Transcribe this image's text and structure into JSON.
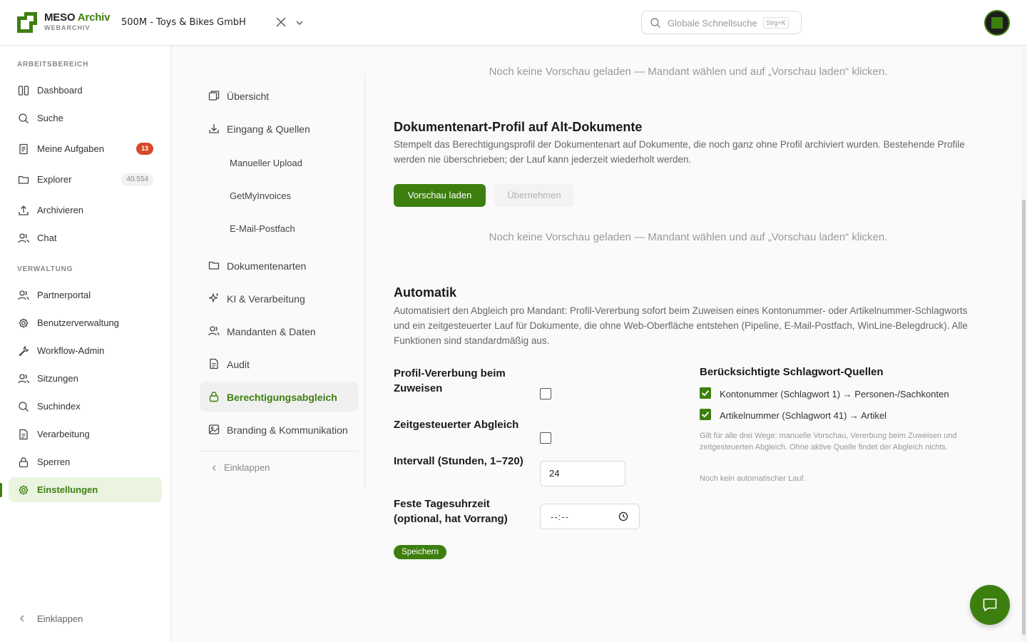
{
  "brand": {
    "name": "MESO",
    "name_accent": "Archiv",
    "sub": "WEBARCHIV"
  },
  "header": {
    "tenant": "500M - Toys & Bikes GmbH",
    "search_placeholder": "Globale Schnellsuche",
    "search_shortcut": "Strg+K"
  },
  "sidebar": {
    "section_work": "ARBEITSBEREICH",
    "section_admin": "VERWALTUNG",
    "work_items": [
      {
        "label": "Dashboard",
        "icon": "dashboard-icon"
      },
      {
        "label": "Suche",
        "icon": "search-icon"
      },
      {
        "label": "Meine Aufgaben",
        "icon": "tasks-icon",
        "badge": "13"
      },
      {
        "label": "Explorer",
        "icon": "folder-icon",
        "count": "40.554"
      },
      {
        "label": "Archivieren",
        "icon": "upload-icon"
      },
      {
        "label": "Chat",
        "icon": "users-icon"
      }
    ],
    "admin_items": [
      {
        "label": "Partnerportal",
        "icon": "users-icon"
      },
      {
        "label": "Benutzerverwaltung",
        "icon": "gear-icon"
      },
      {
        "label": "Workflow-Admin",
        "icon": "wrench-icon"
      },
      {
        "label": "Sitzungen",
        "icon": "users-icon"
      },
      {
        "label": "Suchindex",
        "icon": "search-icon"
      },
      {
        "label": "Verarbeitung",
        "icon": "document-icon"
      },
      {
        "label": "Sperren",
        "icon": "lock-icon"
      },
      {
        "label": "Einstellungen",
        "icon": "gear-icon",
        "active": true
      }
    ],
    "collapse": "Einklappen"
  },
  "subnav": {
    "items": [
      {
        "label": "Übersicht",
        "icon": "copy-icon"
      },
      {
        "label": "Eingang & Quellen",
        "icon": "download-icon"
      },
      {
        "label": "Manueller Upload"
      },
      {
        "label": "GetMyInvoices"
      },
      {
        "label": "E-Mail-Postfach"
      },
      {
        "label": "Dokumentenarten",
        "icon": "folder-icon"
      },
      {
        "label": "KI & Verarbeitung",
        "icon": "sparkle-icon"
      },
      {
        "label": "Mandanten & Daten",
        "icon": "users-icon"
      },
      {
        "label": "Audit",
        "icon": "document-icon"
      },
      {
        "label": "Berechtigungsabgleich",
        "icon": "lock-icon",
        "active": true
      },
      {
        "label": "Branding & Kommunikation",
        "icon": "image-icon"
      }
    ],
    "collapse": "Einklappen"
  },
  "main": {
    "empty_top": "Noch keine Vorschau geladen — Mandant wählen und auf „Vorschau laden“ klicken.",
    "section1": {
      "title": "Dokumentenart-Profil auf Alt-Dokumente",
      "description": "Stempelt das Berechtigungsprofil der Dokumentenart auf Dokumente, die noch ganz ohne Profil archiviert wurden. Bestehende Profile werden nie überschrieben; der Lauf kann jederzeit wiederholt werden.",
      "btn_preview": "Vorschau laden",
      "btn_apply": "Übernehmen",
      "empty": "Noch keine Vorschau geladen — Mandant wählen und auf „Vorschau laden“ klicken."
    },
    "section2": {
      "title": "Automatik",
      "description": "Automatisiert den Abgleich pro Mandant: Profil-Vererbung sofort beim Zuweisen eines Kontonummer- oder Artikelnummer-Schlagworts und ein zeitgesteuerter Lauf für Dokumente, die ohne Web-Oberfläche entstehen (Pipeline, E-Mail-Postfach, WinLine-Belegdruck). Alle Funktionen sind standardmäßig aus.",
      "inherit_label": "Profil-Vererbung beim Zuweisen",
      "scheduled_label": "Zeitgesteuerter Abgleich",
      "interval_label": "Intervall (Stunden, 1–720)",
      "interval_value": "24",
      "fixed_time_label": "Feste Tagesuhrzeit (optional, hat Vorrang)",
      "fixed_time_value": "--:--",
      "save": "Speichern",
      "sources_title": "Berücksichtigte Schlagwort-Quellen",
      "source1": "Kontonummer (Schlagwort 1) → Personen-/Sachkonten",
      "source2": "Artikelnummer (Schlagwort 41) → Artikel",
      "note": "Gilt für alle drei Wege: manuelle Vorschau, Vererbung beim Zuweisen und zeitgesteuerten Abgleich. Ohne aktive Quelle findet der Abgleich nichts.",
      "status": "Noch kein automatischer Lauf."
    }
  },
  "colors": {
    "accent": "#3d7f0f",
    "badge": "#d54a2a"
  }
}
